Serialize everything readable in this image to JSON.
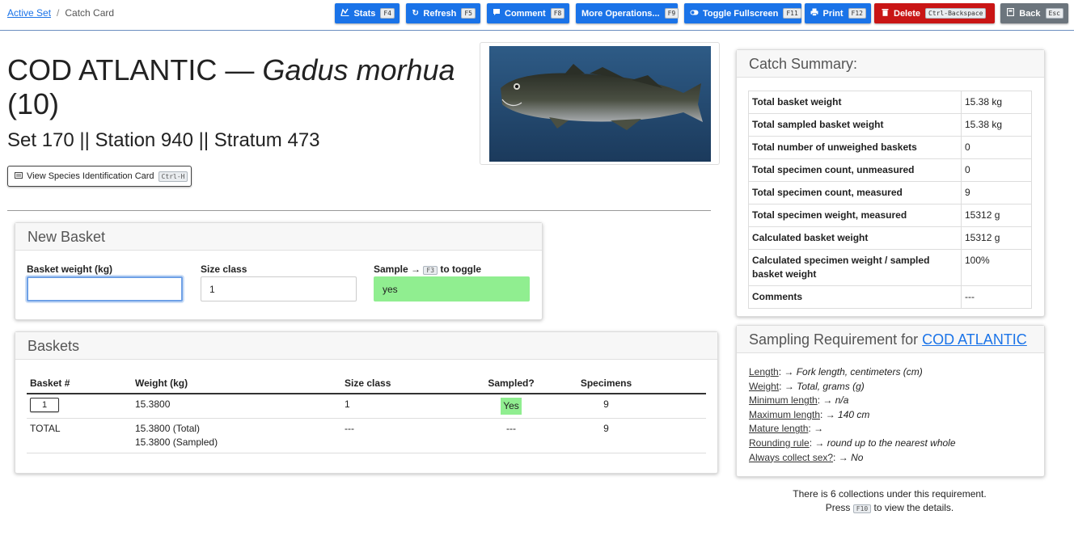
{
  "breadcrumb": {
    "root": "Active Set",
    "current": "Catch Card"
  },
  "toolbar": {
    "stats": {
      "label": "Stats",
      "key": "F4",
      "icon": "chart-icon"
    },
    "refresh": {
      "label": "Refresh",
      "key": "F5",
      "icon": "refresh-icon"
    },
    "comment": {
      "label": "Comment",
      "key": "F8",
      "icon": "comment-icon"
    },
    "more": {
      "label": "More Operations...",
      "key": "F9"
    },
    "fullscreen": {
      "label": "Toggle Fullscreen",
      "key": "F11",
      "icon": "toggle-icon"
    },
    "print": {
      "label": "Print",
      "key": "F12",
      "icon": "printer-icon"
    },
    "delete": {
      "label": "Delete",
      "key": "Ctrl-Backspace",
      "icon": "trash-icon"
    },
    "back": {
      "label": "Back",
      "key": "Esc",
      "icon": "back-icon"
    }
  },
  "header": {
    "species_common": "COD ATLANTIC",
    "dash": "—",
    "species_latin": "Gadus morhua",
    "code": "(10)",
    "subtitle": "Set 170 || Station 940 || Stratum 473",
    "id_card_button": "View Species Identification Card",
    "id_card_key": "Ctrl-H"
  },
  "new_basket": {
    "title": "New Basket",
    "weight_label": "Basket weight (kg)",
    "weight_value": "",
    "size_label": "Size class",
    "size_value": "1",
    "sample_label_prefix": "Sample →",
    "sample_key": "F3",
    "sample_label_suffix": "to toggle",
    "sample_value": "yes"
  },
  "baskets": {
    "title": "Baskets",
    "columns": [
      "Basket #",
      "Weight (kg)",
      "Size class",
      "Sampled?",
      "Specimens"
    ],
    "rows": [
      {
        "num": "1",
        "weight": "15.3800",
        "size": "1",
        "sampled": "Yes",
        "specimens": "9"
      }
    ],
    "total": {
      "label": "TOTAL",
      "weight_total": "15.3800 (Total)",
      "weight_sampled": "15.3800 (Sampled)",
      "size": "---",
      "sampled": "---",
      "specimens": "9"
    }
  },
  "catch_summary": {
    "title": "Catch Summary:",
    "rows": [
      {
        "label": "Total basket weight",
        "value": "15.38 kg"
      },
      {
        "label": "Total sampled basket weight",
        "value": "15.38 kg"
      },
      {
        "label": "Total number of unweighed baskets",
        "value": "0"
      },
      {
        "label": "Total specimen count, unmeasured",
        "value": "0"
      },
      {
        "label": "Total specimen count, measured",
        "value": "9"
      },
      {
        "label": "Total specimen weight, measured",
        "value": "15312 g"
      },
      {
        "label": "Calculated basket weight",
        "value": "15312 g"
      },
      {
        "label": "Calculated specimen weight / sampled basket weight",
        "value": "100%"
      },
      {
        "label": "Comments",
        "value": "---"
      }
    ]
  },
  "sampling": {
    "title_prefix": "Sampling Requirement for",
    "title_link": "COD ATLANTIC",
    "arrow": "→",
    "items": [
      {
        "label": "Length",
        "value": "Fork length, centimeters (cm)"
      },
      {
        "label": "Weight",
        "value": "Total, grams (g)"
      },
      {
        "label": "Minimum length",
        "value": "n/a"
      },
      {
        "label": "Maximum length",
        "value": "140 cm"
      },
      {
        "label": "Mature length",
        "value": ""
      },
      {
        "label": "Rounding rule",
        "value": "round up to the nearest whole"
      },
      {
        "label": "Always collect sex?",
        "value": "No"
      }
    ],
    "note_line1": "There is 6 collections under this requirement.",
    "note_press": "Press",
    "note_key": "F10",
    "note_line2": "to view the details."
  },
  "colors": {
    "primary": "#1a73e8",
    "danger": "#c91515",
    "secondary": "#6c757d",
    "sampled_green": "#90ee90"
  }
}
